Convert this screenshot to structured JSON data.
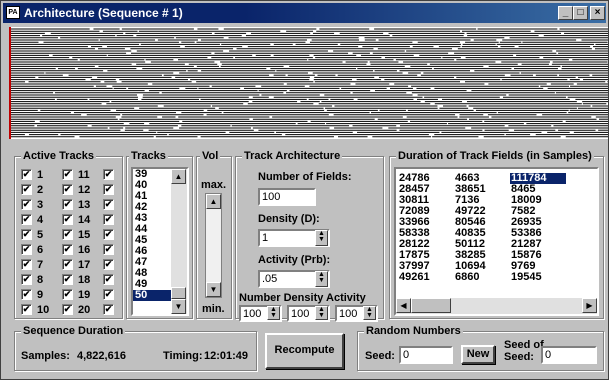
{
  "window": {
    "title": "Architecture (Sequence # 1)",
    "minimize_label": "_",
    "restore_label": "□",
    "close_label": "×"
  },
  "active_tracks": {
    "label": "Active Tracks",
    "col1": [
      "1",
      "2",
      "3",
      "4",
      "5",
      "6",
      "7",
      "8",
      "9",
      "10"
    ],
    "col2": [
      "11",
      "12",
      "13",
      "14",
      "15",
      "16",
      "17",
      "18",
      "19",
      "20"
    ],
    "check_glyph": "✔"
  },
  "tracks_list": {
    "label": "Tracks",
    "items": [
      "39",
      "40",
      "41",
      "42",
      "43",
      "44",
      "45",
      "46",
      "47",
      "48",
      "49",
      "50"
    ],
    "selected": "50"
  },
  "volume": {
    "label": "Vol",
    "max_label": "max.",
    "min_label": "min."
  },
  "track_architecture": {
    "label": "Track Architecture",
    "fields_label": "Number of Fields:",
    "fields_value": "100",
    "density_label": "Density (D):",
    "density_value": "1",
    "activity_label": "Activity (Prb):",
    "activity_value": ".05",
    "bottom_labels": "Number Density Activity",
    "number_value": "100",
    "density_pct": "100",
    "activity_pct": "100"
  },
  "durations": {
    "label": "Duration of Track Fields (in Samples)",
    "rows": [
      [
        "24786",
        "4663",
        "111784"
      ],
      [
        "28457",
        "38651",
        "8465"
      ],
      [
        "30811",
        "7136",
        "18009"
      ],
      [
        "72089",
        "49722",
        "7582"
      ],
      [
        "33966",
        "80546",
        "26935"
      ],
      [
        "58338",
        "40835",
        "53386"
      ],
      [
        "28122",
        "50112",
        "21287"
      ],
      [
        "17875",
        "38285",
        "15876"
      ],
      [
        "37997",
        "10694",
        "9769"
      ],
      [
        "49261",
        "6860",
        "19545"
      ]
    ],
    "selected": "111784"
  },
  "sequence_duration": {
    "label": "Sequence Duration",
    "samples_label": "Samples:",
    "samples_value": "4,822,616",
    "timing_label": "Timing:",
    "timing_value": "12:01:49"
  },
  "recompute_label": "Recompute",
  "random_numbers": {
    "label": "Random Numbers",
    "seed_label": "Seed:",
    "seed_value": "0",
    "new_label": "New",
    "seed_of_label_1": "Seed of",
    "seed_of_label_2": "Seed:",
    "seed_of_value": "0"
  },
  "colors": {
    "titlebar": "#0a246a",
    "selection": "#0a246a",
    "face": "#c0c0c0",
    "canvas_marker": "#c00000"
  }
}
